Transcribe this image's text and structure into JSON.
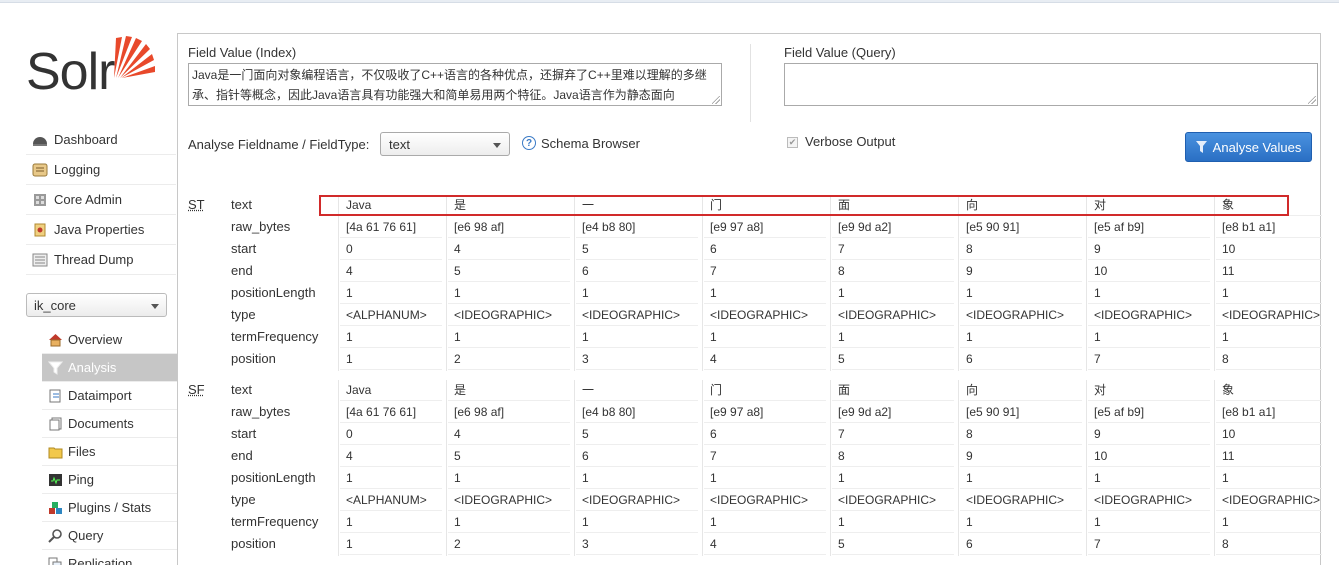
{
  "logo": {
    "text": "Solr"
  },
  "nav": [
    {
      "label": "Dashboard",
      "icon": "dashboard-icon"
    },
    {
      "label": "Logging",
      "icon": "logging-icon"
    },
    {
      "label": "Core Admin",
      "icon": "core-admin-icon"
    },
    {
      "label": "Java Properties",
      "icon": "java-properties-icon"
    },
    {
      "label": "Thread Dump",
      "icon": "thread-dump-icon"
    }
  ],
  "core_selector": {
    "value": "ik_core"
  },
  "core_nav": [
    {
      "label": "Overview",
      "icon": "home-icon",
      "active": false
    },
    {
      "label": "Analysis",
      "icon": "funnel-icon",
      "active": true
    },
    {
      "label": "Dataimport",
      "icon": "dataimport-icon",
      "active": false
    },
    {
      "label": "Documents",
      "icon": "documents-icon",
      "active": false
    },
    {
      "label": "Files",
      "icon": "files-icon",
      "active": false
    },
    {
      "label": "Ping",
      "icon": "ping-icon",
      "active": false
    },
    {
      "label": "Plugins / Stats",
      "icon": "plugins-icon",
      "active": false
    },
    {
      "label": "Query",
      "icon": "query-icon",
      "active": false
    },
    {
      "label": "Replication",
      "icon": "replication-icon",
      "active": false
    }
  ],
  "form": {
    "index_label": "Field Value (Index)",
    "index_value": "Java是一门面向对象编程语言，不仅吸收了C++语言的各种优点，还摒弃了C++里难以理解的多继承、指针等概念，因此Java语言具有功能强大和简单易用两个特征。Java语言作为静态面向",
    "query_label": "Field Value (Query)",
    "query_value": "",
    "fieldtype_label": "Analyse Fieldname / FieldType:",
    "fieldtype_value": "text",
    "schema_browser": "Schema Browser",
    "verbose_label": "Verbose Output",
    "verbose_checked": true,
    "analyse_button": "Analyse Values"
  },
  "stages": [
    {
      "abbr": "ST",
      "attributes": [
        "text",
        "raw_bytes",
        "start",
        "end",
        "positionLength",
        "type",
        "termFrequency",
        "position"
      ],
      "tokens": [
        [
          "Java",
          "[4a 61 76 61]",
          "0",
          "4",
          "1",
          "<ALPHANUM>",
          "1",
          "1"
        ],
        [
          "是",
          "[e6 98 af]",
          "4",
          "5",
          "1",
          "<IDEOGRAPHIC>",
          "1",
          "2"
        ],
        [
          "一",
          "[e4 b8 80]",
          "5",
          "6",
          "1",
          "<IDEOGRAPHIC>",
          "1",
          "3"
        ],
        [
          "门",
          "[e9 97 a8]",
          "6",
          "7",
          "1",
          "<IDEOGRAPHIC>",
          "1",
          "4"
        ],
        [
          "面",
          "[e9 9d a2]",
          "7",
          "8",
          "1",
          "<IDEOGRAPHIC>",
          "1",
          "5"
        ],
        [
          "向",
          "[e5 90 91]",
          "8",
          "9",
          "1",
          "<IDEOGRAPHIC>",
          "1",
          "6"
        ],
        [
          "对",
          "[e5 af b9]",
          "9",
          "10",
          "1",
          "<IDEOGRAPHIC>",
          "1",
          "7"
        ],
        [
          "象",
          "[e8 b1 a1]",
          "10",
          "11",
          "1",
          "<IDEOGRAPHIC>",
          "1",
          "8"
        ]
      ]
    },
    {
      "abbr": "SF",
      "attributes": [
        "text",
        "raw_bytes",
        "start",
        "end",
        "positionLength",
        "type",
        "termFrequency",
        "position"
      ],
      "tokens": [
        [
          "Java",
          "[4a 61 76 61]",
          "0",
          "4",
          "1",
          "<ALPHANUM>",
          "1",
          "1"
        ],
        [
          "是",
          "[e6 98 af]",
          "4",
          "5",
          "1",
          "<IDEOGRAPHIC>",
          "1",
          "2"
        ],
        [
          "一",
          "[e4 b8 80]",
          "5",
          "6",
          "1",
          "<IDEOGRAPHIC>",
          "1",
          "3"
        ],
        [
          "门",
          "[e9 97 a8]",
          "6",
          "7",
          "1",
          "<IDEOGRAPHIC>",
          "1",
          "4"
        ],
        [
          "面",
          "[e9 9d a2]",
          "7",
          "8",
          "1",
          "<IDEOGRAPHIC>",
          "1",
          "5"
        ],
        [
          "向",
          "[e5 90 91]",
          "8",
          "9",
          "1",
          "<IDEOGRAPHIC>",
          "1",
          "6"
        ],
        [
          "对",
          "[e5 af b9]",
          "9",
          "10",
          "1",
          "<IDEOGRAPHIC>",
          "1",
          "7"
        ],
        [
          "象",
          "[e8 b1 a1]",
          "10",
          "11",
          "1",
          "<IDEOGRAPHIC>",
          "1",
          "8"
        ]
      ]
    }
  ],
  "colors": {
    "accent": "#2a6fc4",
    "highlight_box": "#d12a2a",
    "logo_orange": "#e8492b"
  }
}
